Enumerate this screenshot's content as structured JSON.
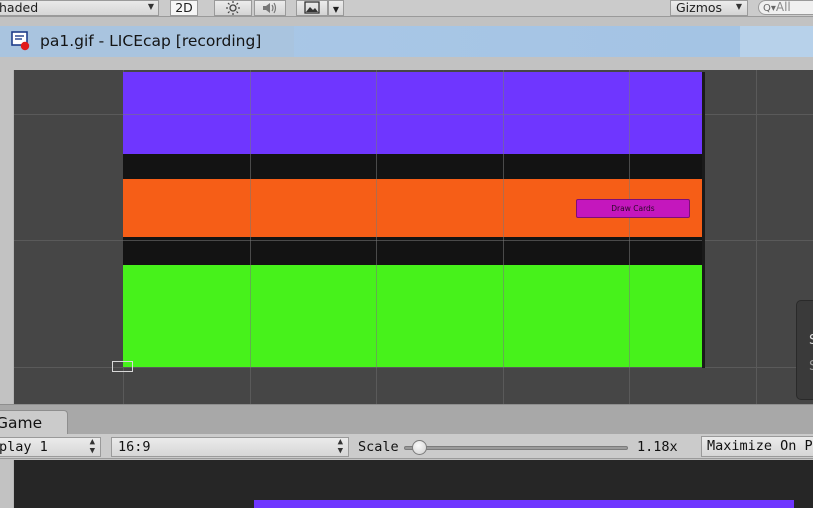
{
  "scene_toolbar": {
    "shading_mode": "haded",
    "mode_2d": "2D",
    "gizmos": "Gizmos",
    "search_placeholder": "All",
    "icons": [
      "sun-icon",
      "speaker-icon",
      "image-icon"
    ]
  },
  "licecap": {
    "title": "pa1.gif - LICEcap [recording]"
  },
  "scene_view": {
    "bands": [
      {
        "name": "purple",
        "color": "#6f36ff"
      },
      {
        "name": "dark",
        "color": "#131313"
      },
      {
        "name": "orange",
        "color": "#f65e17"
      },
      {
        "name": "dark",
        "color": "#131313"
      },
      {
        "name": "green",
        "color": "#47f21b"
      }
    ],
    "draw_cards_button": {
      "label": "Draw Cards",
      "color": "#c417bd"
    },
    "side_popup": {
      "line1": "S",
      "line2": "S"
    }
  },
  "game_tab": {
    "label": "Game",
    "display": "play 1",
    "aspect": "16:9",
    "scale_label": "Scale",
    "scale_value": "1.18x",
    "scale_fraction": 0.07,
    "maximize_on_play": "Maximize On Pla"
  }
}
